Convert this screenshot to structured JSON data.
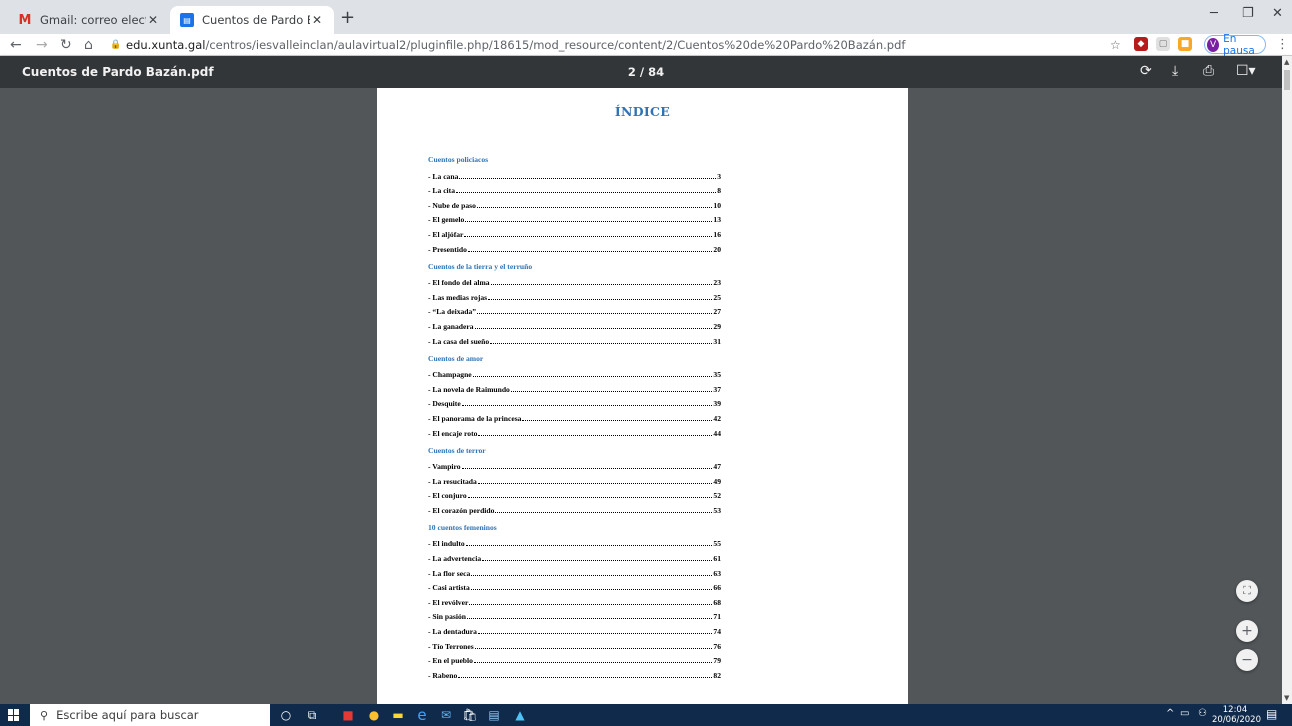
{
  "browser": {
    "tabs": [
      {
        "title": "Gmail: correo electrónico y alma",
        "icon": "gmail-icon",
        "active": false
      },
      {
        "title": "Cuentos de Pardo Bazán.pdf",
        "icon": "pdf-icon",
        "active": true
      }
    ],
    "url_host": "edu.xunta.gal",
    "url_path": "/centros/iesvalleinclan/aulavirtual2/pluginfile.php/18615/mod_resource/content/2/Cuentos%20de%20Pardo%20Bazán.pdf",
    "profile_initial": "V",
    "profile_label": "En pausa"
  },
  "pdf_toolbar": {
    "title": "Cuentos de Pardo Bazán.pdf",
    "page_indicator": "2 / 84"
  },
  "document": {
    "heading": "ÍNDICE",
    "sections": [
      {
        "title": "Cuentos policiacos",
        "entries": [
          {
            "label": "- La cana",
            "page": "3"
          },
          {
            "label": "- La cita",
            "page": "8"
          },
          {
            "label": "- Nube de paso",
            "page": "10"
          },
          {
            "label": "- El gemelo",
            "page": "13"
          },
          {
            "label": "- El aljófar",
            "page": "16"
          },
          {
            "label": "- Presentido",
            "page": "20"
          }
        ]
      },
      {
        "title": "Cuentos de la tierra y el terruño",
        "entries": [
          {
            "label": "- El fondo del alma",
            "page": "23"
          },
          {
            "label": "- Las medias rojas",
            "page": "25"
          },
          {
            "label": "- “La deixada”",
            "page": "27"
          },
          {
            "label": "- La ganadera",
            "page": "29"
          },
          {
            "label": "- La casa del sueño",
            "page": "31"
          }
        ]
      },
      {
        "title": "Cuentos de amor",
        "entries": [
          {
            "label": "- Champagne",
            "page": "35"
          },
          {
            "label": "- La novela de Raimundo",
            "page": "37"
          },
          {
            "label": "- Desquite",
            "page": "39"
          },
          {
            "label": "- El panorama de la princesa",
            "page": "42"
          },
          {
            "label": "- El encaje roto",
            "page": "44"
          }
        ]
      },
      {
        "title": "Cuentos de terror",
        "entries": [
          {
            "label": "- Vampiro",
            "page": "47"
          },
          {
            "label": "- La resucitada",
            "page": "49"
          },
          {
            "label": "- El conjuro",
            "page": "52"
          },
          {
            "label": "- El corazón perdido",
            "page": "53"
          }
        ]
      },
      {
        "title": "10 cuentos femeninos",
        "entries": [
          {
            "label": "-  El indulto",
            "page": "55"
          },
          {
            "label": "-  La advertencia",
            "page": "61"
          },
          {
            "label": "-  La flor seca",
            "page": "63"
          },
          {
            "label": "-  Casi artista",
            "page": "66"
          },
          {
            "label": "-  El revólver",
            "page": "68"
          },
          {
            "label": "-  Sin pasión",
            "page": "71"
          },
          {
            "label": "-  La dentadura",
            "page": "74"
          },
          {
            "label": "-  Tío Terrones",
            "page": "76"
          },
          {
            "label": "-  En el pueblo",
            "page": "79"
          },
          {
            "label": "-  Rabeno",
            "page": "82"
          }
        ]
      }
    ]
  },
  "taskbar": {
    "search_placeholder": "Escribe aquí para buscar",
    "time": "12:04",
    "date": "20/06/2020"
  },
  "colors": {
    "toc_heading": "#2e74b5",
    "pdf_toolbar_bg": "#323639",
    "viewer_bg": "#525659",
    "taskbar_bg": "#0f2a4a"
  }
}
